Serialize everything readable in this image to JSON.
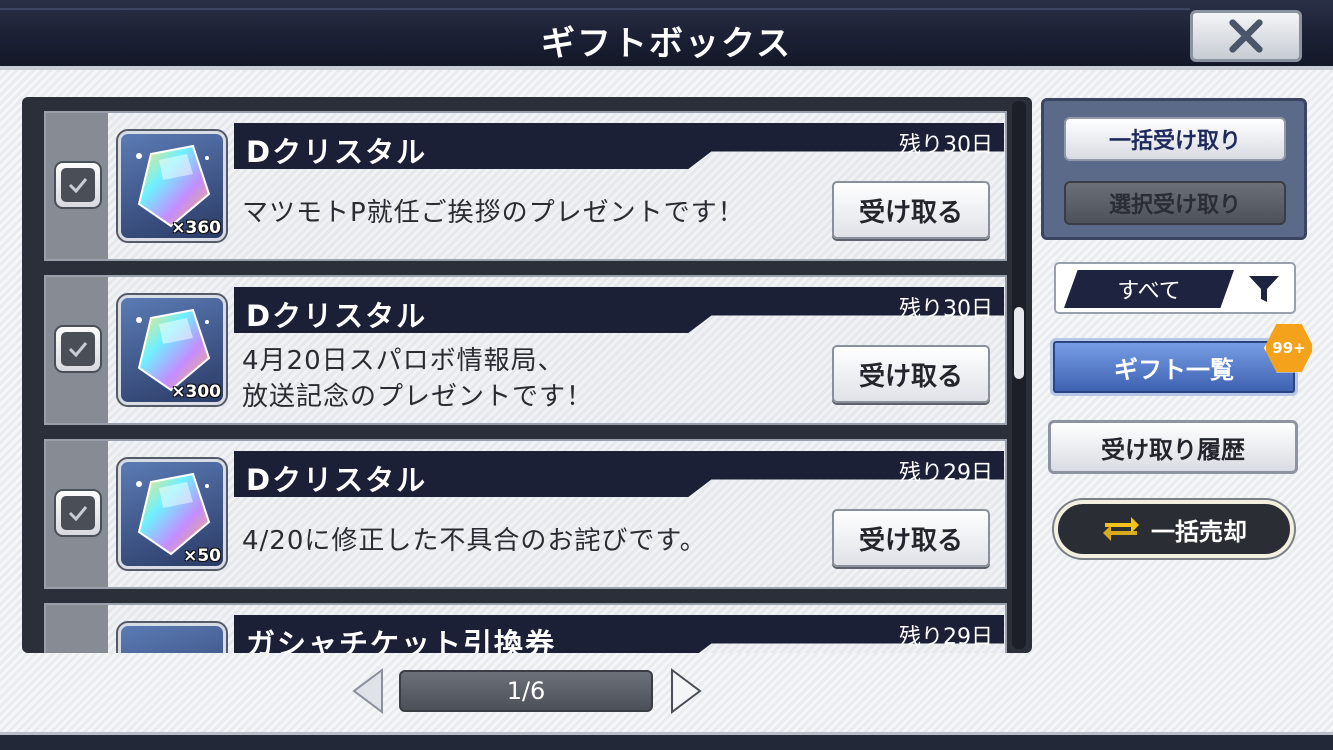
{
  "header": {
    "title": "ギフトボックス",
    "close_icon": "close-icon"
  },
  "gifts": [
    {
      "name": "Dクリスタル",
      "remaining": "残り30日",
      "quantity": "×360",
      "description": "マツモトP就任ご挨拶のプレゼントです！",
      "button": "受け取る",
      "checked": true
    },
    {
      "name": "Dクリスタル",
      "remaining": "残り30日",
      "quantity": "×300",
      "description_line1": "4月20日スパロボ情報局、",
      "description_line2": "放送記念のプレゼントです！",
      "button": "受け取る",
      "checked": true
    },
    {
      "name": "Dクリスタル",
      "remaining": "残り29日",
      "quantity": "×50",
      "description": "4/20に修正した不具合のお詫びです。",
      "button": "受け取る",
      "checked": true
    },
    {
      "name": "ガシャチケット引換券",
      "remaining": "残り29日"
    }
  ],
  "sidebar": {
    "bulk_receive": "一括受け取り",
    "select_receive": "選択受け取り",
    "filter_label": "すべて",
    "gift_list": "ギフト一覧",
    "badge": "99+",
    "history": "受け取り履歴",
    "bulk_sell": "一括売却"
  },
  "pagination": {
    "page": "1/6"
  },
  "colors": {
    "header_bg": "#1a1f33",
    "accent_blue": "#3c5fae",
    "badge_orange": "#f4a21b"
  }
}
